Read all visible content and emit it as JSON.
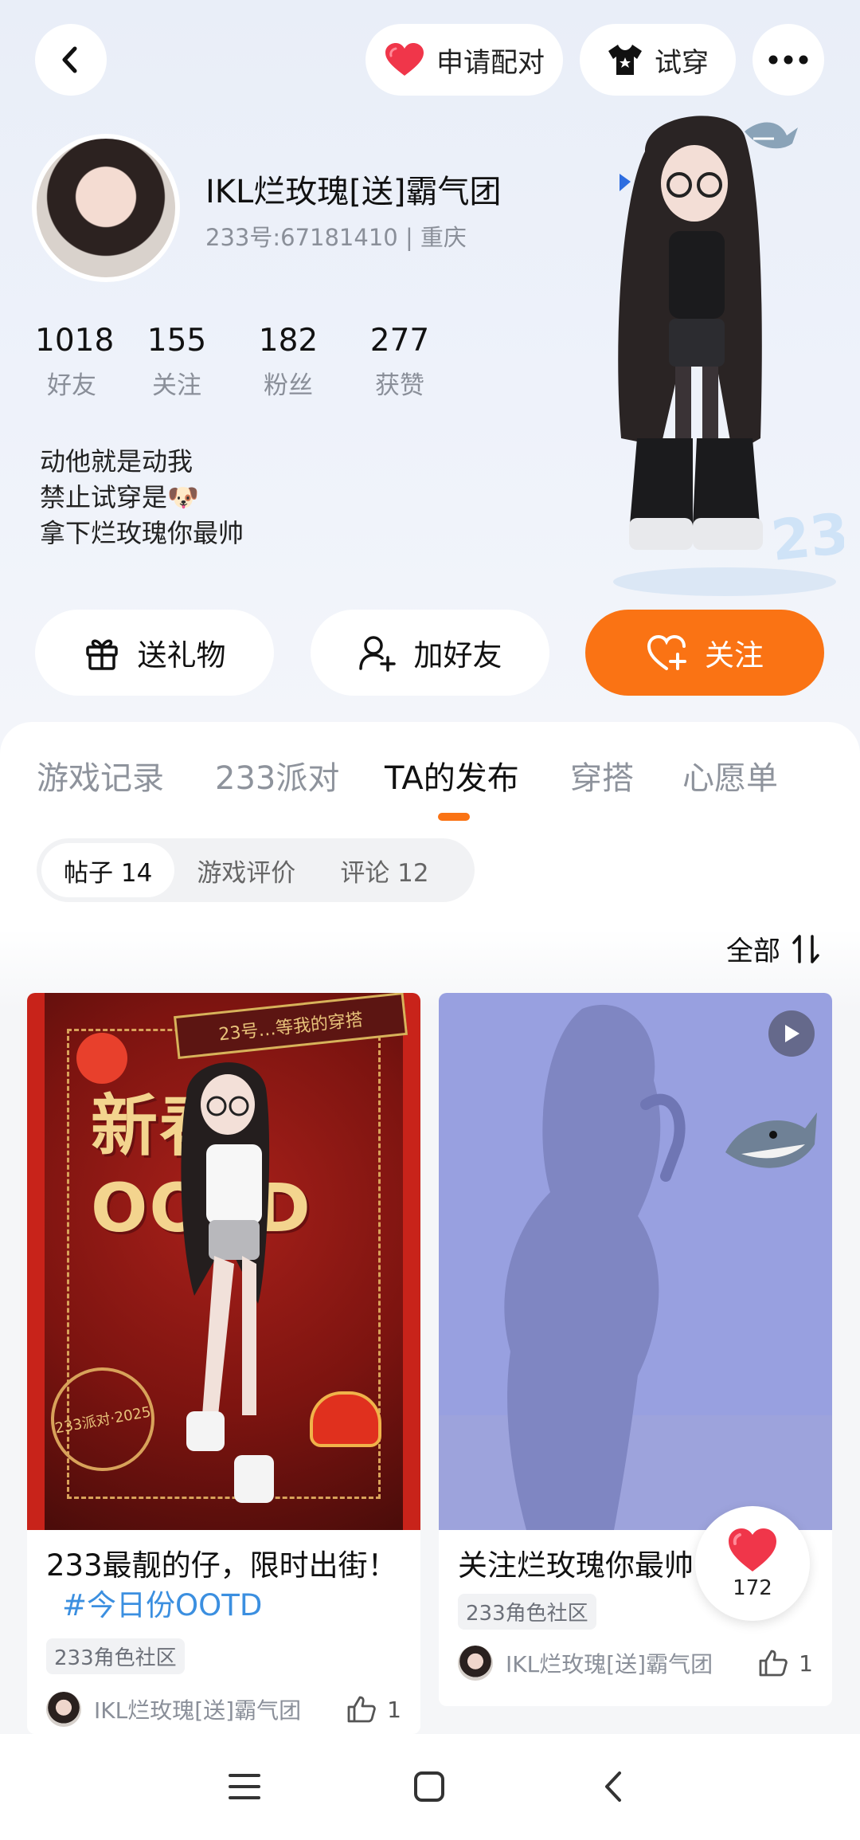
{
  "header": {
    "match_label": "申请配对",
    "tryon_label": "试穿"
  },
  "profile": {
    "nickname": "IKL烂玫瑰[送]霸气团",
    "uid_line": "233号:67181410 | 重庆",
    "stats": [
      {
        "value": "1018",
        "label": "好友"
      },
      {
        "value": "155",
        "label": "关注"
      },
      {
        "value": "182",
        "label": "粉丝"
      },
      {
        "value": "277",
        "label": "获赞"
      }
    ],
    "bio_lines": [
      "动他就是动我",
      "禁止试穿是🐶",
      "拿下烂玫瑰你最帅"
    ]
  },
  "actions": {
    "gift": "送礼物",
    "add_friend": "加好友",
    "follow": "关注"
  },
  "tabs": [
    "游戏记录",
    "233派对",
    "TA的发布",
    "穿搭",
    "心愿单"
  ],
  "segments": [
    "帖子 14",
    "游戏评价",
    "评论 12"
  ],
  "sort_label": "全部",
  "posts": [
    {
      "title": "233最靓的仔，限时出街！",
      "hashtag": "#今日份OOTD",
      "tag": "233角色社区",
      "author": "IKL烂玫瑰[送]霸气团",
      "likes": "1",
      "image_text": "新春OOTD",
      "banner_text": "23号…等我的穿搭",
      "stamp_text": "233派对·2025"
    },
    {
      "title": "关注烂玫瑰你最帅",
      "tag": "233角色社区",
      "author": "IKL烂玫瑰[送]霸气团",
      "likes": "1"
    }
  ],
  "floating_like": {
    "count": "172"
  },
  "colors": {
    "accent": "#fa7314",
    "hashtag": "#3b8fe0",
    "like_red": "#f0364a"
  }
}
